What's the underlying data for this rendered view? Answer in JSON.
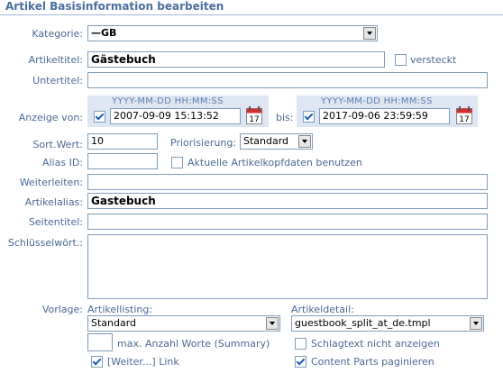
{
  "header": {
    "title": "Artikel Basisinformation bearbeiten"
  },
  "kategorie": {
    "label": "Kategorie:",
    "value": "—GB"
  },
  "artikeltitel": {
    "label": "Artikeltitel:",
    "value": "Gästebuch",
    "versteckt_label": "versteckt",
    "versteckt_checked": false
  },
  "untertitel": {
    "label": "Untertitel:",
    "value": ""
  },
  "anzeige": {
    "label": "Anzeige von:",
    "from_format": "YYYY-MM-DD HH:MM:SS",
    "from_value": "2007-09-09 15:13:52",
    "from_checked": true,
    "bis_label": "bis:",
    "to_format": "YYYY-MM-DD HH:MM:SS",
    "to_value": "2017-09-06 23:59:59",
    "to_checked": true
  },
  "sortwert": {
    "label": "Sort.Wert:",
    "value": "10"
  },
  "priorisierung": {
    "label": "Priorisierung:",
    "value": "Standard"
  },
  "aliasid": {
    "label": "Alias ID:",
    "value": "",
    "aktuelle_label": "Aktuelle Artikelkopfdaten benutzen",
    "aktuelle_checked": false
  },
  "weiterleiten": {
    "label": "Weiterleiten:",
    "value": ""
  },
  "artikelalias": {
    "label": "Artikelalias:",
    "value": "Gastebuch"
  },
  "seitentitel": {
    "label": "Seitentitel:",
    "value": ""
  },
  "schluesselwort": {
    "label": "Schlüsselwört.:",
    "value": ""
  },
  "vorlage": {
    "label": "Vorlage:",
    "listing_label": "Artikellisting:",
    "listing_value": "Standard",
    "detail_label": "Artikeldetail:",
    "detail_value": "guestbook_split_at_de.tmpl",
    "maxworte_value": "",
    "maxworte_label": "max. Anzahl Worte (Summary)",
    "schlagtext_label": "Schlagtext nicht anzeigen",
    "schlagtext_checked": false,
    "weiter_label": "[Weiter...] Link",
    "weiter_checked": true,
    "contentparts_label": "Content Parts paginieren",
    "contentparts_checked": true
  },
  "icons": {
    "calendar": "calendar-icon",
    "dropdown": "chevron-down-icon"
  }
}
